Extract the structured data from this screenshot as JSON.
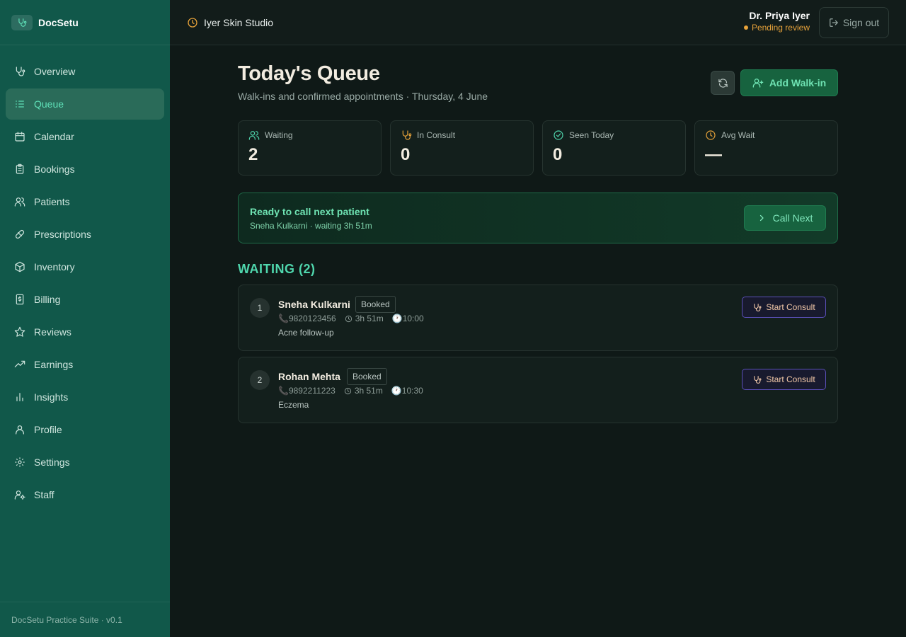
{
  "app": {
    "name": "DocSetu",
    "footer": "DocSetu Practice Suite · v0.1"
  },
  "sidebar": {
    "items": [
      {
        "label": "Overview",
        "icon": "stethoscope-icon",
        "active": false
      },
      {
        "label": "Queue",
        "icon": "list-icon",
        "active": true
      },
      {
        "label": "Calendar",
        "icon": "calendar-icon",
        "active": false
      },
      {
        "label": "Bookings",
        "icon": "clipboard-icon",
        "active": false
      },
      {
        "label": "Patients",
        "icon": "users-icon",
        "active": false
      },
      {
        "label": "Prescriptions",
        "icon": "pill-icon",
        "active": false
      },
      {
        "label": "Inventory",
        "icon": "box-icon",
        "active": false
      },
      {
        "label": "Billing",
        "icon": "receipt-icon",
        "active": false
      },
      {
        "label": "Reviews",
        "icon": "star-icon",
        "active": false
      },
      {
        "label": "Earnings",
        "icon": "trending-up-icon",
        "active": false
      },
      {
        "label": "Insights",
        "icon": "bar-chart-icon",
        "active": false
      },
      {
        "label": "Profile",
        "icon": "user-icon",
        "active": false
      },
      {
        "label": "Settings",
        "icon": "gear-icon",
        "active": false
      },
      {
        "label": "Staff",
        "icon": "user-cog-icon",
        "active": false
      }
    ]
  },
  "topbar": {
    "clinic_name": "Iyer Skin Studio",
    "user_name": "Dr. Priya Iyer",
    "user_status": "Pending review",
    "signout_label": "Sign out"
  },
  "page": {
    "title": "Today's Queue",
    "subtitle": "Walk-ins and confirmed appointments · Thursday, 4 June",
    "add_walkin_label": "Add Walk-in"
  },
  "stats": [
    {
      "label": "Waiting",
      "value": "2",
      "icon": "users-icon"
    },
    {
      "label": "In Consult",
      "value": "0",
      "icon": "stethoscope-icon"
    },
    {
      "label": "Seen Today",
      "value": "0",
      "icon": "check-circle-icon"
    },
    {
      "label": "Avg Wait",
      "value": "—",
      "icon": "clock-icon"
    }
  ],
  "call_next": {
    "title": "Ready to call next patient",
    "subtitle": "Sneha Kulkarni · waiting 3h 51m",
    "button_label": "Call Next"
  },
  "queue": {
    "section_title": "WAITING (2)",
    "button_label": "Start Consult",
    "patients": [
      {
        "position": "1",
        "name": "Sneha Kulkarni",
        "status": "Booked",
        "phone": "9820123456",
        "waiting": "3h 51m",
        "time": "10:00",
        "note": "Acne follow-up"
      },
      {
        "position": "2",
        "name": "Rohan Mehta",
        "status": "Booked",
        "phone": "9892211223",
        "waiting": "3h 51m",
        "time": "10:30",
        "note": "Eczema"
      }
    ]
  },
  "colors": {
    "sidebar": "#11584a",
    "accent": "#4fd6ad",
    "warning": "#e8a33a",
    "primary_button": "#17633f"
  }
}
